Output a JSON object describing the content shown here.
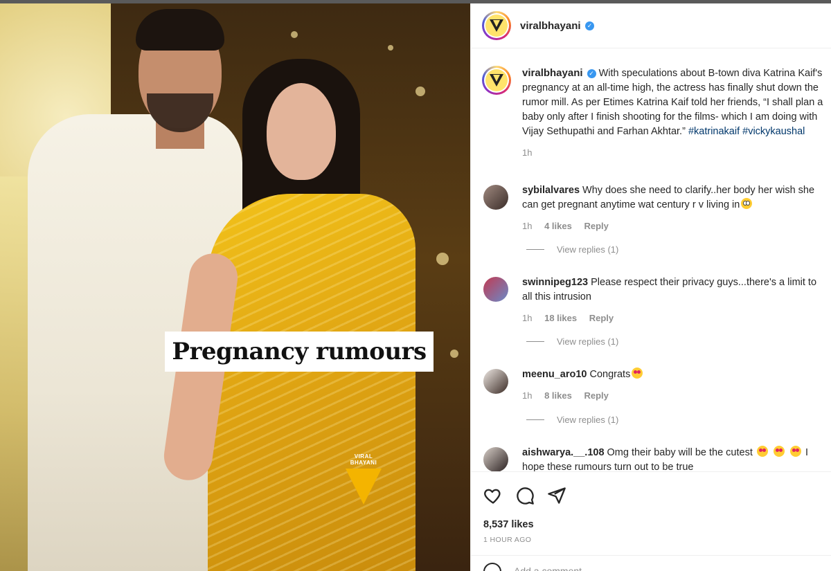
{
  "post": {
    "username": "viralbhayani",
    "image_caption": "Pregnancy rumours",
    "watermark": "VIRAL BHAYANI",
    "caption_text": "With speculations about B-town diva Katrina Kaif's pregnancy at an all-time high, the actress has finally shut down the rumor mill. As per Etimes Katrina Kaif told her friends, “I shall plan a baby only after I finish shooting for the films- which I am doing with Vijay Sethupathi and Farhan Akhtar.”",
    "hashtags": "#katrinakaif #vickykaushal",
    "caption_time": "1h",
    "likes": "8,537 likes",
    "posted_ago": "1 HOUR AGO",
    "add_comment_placeholder": "Add a comment..."
  },
  "comments": [
    {
      "username": "sybilalvares",
      "text": "Why does she need to clarify..her body her wish she can get pregnant anytime wat century r v living in",
      "time": "1h",
      "likes": "4 likes",
      "reply": "Reply",
      "view_replies": "View replies (1)"
    },
    {
      "username": "swinnipeg123",
      "text": "Please respect their privacy guys...there's a limit to all this intrusion",
      "time": "1h",
      "likes": "18 likes",
      "reply": "Reply",
      "view_replies": "View replies (1)"
    },
    {
      "username": "meenu_aro10",
      "text": "Congrats",
      "time": "1h",
      "likes": "8 likes",
      "reply": "Reply",
      "view_replies": "View replies (1)"
    },
    {
      "username": "aishwarya.__.108",
      "text": "Omg their baby will be the cutest",
      "text2": "I hope these rumours turn out to be true"
    }
  ],
  "icons": {
    "like": "heart-icon",
    "comment": "comment-icon",
    "share": "share-icon",
    "verified": "verified-badge-icon",
    "emoji": "smiley-icon"
  },
  "colors": {
    "verified": "#3897f0",
    "hashtag": "#00376b",
    "muted": "#8e8e8e",
    "saree": "#e0a513"
  }
}
